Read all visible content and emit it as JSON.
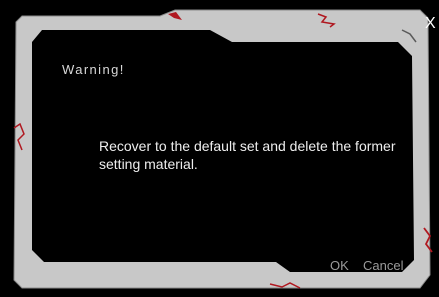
{
  "dialog": {
    "close_label": "X",
    "title": "Warning!",
    "message": "Recover to the default set and delete the former setting material.",
    "ok_label": "OK",
    "cancel_label": "Cancel"
  },
  "colors": {
    "background": "#000000",
    "frame": "#c8c8c8",
    "accent": "#b01820",
    "title_text": "#d8d8d8",
    "message_text": "#eeeeee",
    "button_text": "#9a9a9a"
  }
}
